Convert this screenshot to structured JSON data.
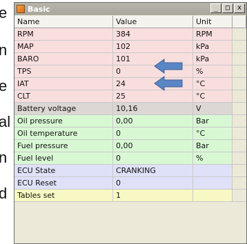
{
  "background_text": [
    "e",
    "n",
    "e",
    "al",
    "n",
    "d"
  ],
  "window": {
    "title": "Basic",
    "buttons": {
      "minimize": "_",
      "maximize": "□",
      "close": "x"
    }
  },
  "table": {
    "columns": [
      "Name",
      "Value",
      "Unit"
    ],
    "rows": [
      {
        "name": "RPM",
        "value": "384",
        "unit": "RPM",
        "color": "#f9dede"
      },
      {
        "name": "MAP",
        "value": "102",
        "unit": "kPa",
        "color": "#f9dede"
      },
      {
        "name": "BARO",
        "value": "101",
        "unit": "kPa",
        "color": "#f9dede"
      },
      {
        "name": "TPS",
        "value": "0",
        "unit": "%",
        "color": "#f9dede"
      },
      {
        "name": "IAT",
        "value": "24",
        "unit": "°C",
        "color": "#f9dede"
      },
      {
        "name": "CLT",
        "value": "25",
        "unit": "°C",
        "color": "#f9dede"
      },
      {
        "name": "Battery voltage",
        "value": "10,16",
        "unit": "V",
        "color": "#dcd7d4"
      },
      {
        "name": "Oil pressure",
        "value": "0,00",
        "unit": "Bar",
        "color": "#d8f8d4"
      },
      {
        "name": "Oil temperature",
        "value": "0",
        "unit": "°C",
        "color": "#d8f8d4"
      },
      {
        "name": "Fuel pressure",
        "value": "0,00",
        "unit": "Bar",
        "color": "#d8f8d4"
      },
      {
        "name": "Fuel level",
        "value": "0",
        "unit": "%",
        "color": "#d8f8d4"
      },
      {
        "name": "ECU State",
        "value": "CRANKING",
        "unit": "",
        "color": "#dfe1f8"
      },
      {
        "name": "ECU Reset",
        "value": "0",
        "unit": "",
        "color": "#dfe1f8"
      },
      {
        "name": "Tables set",
        "value": "1",
        "unit": "",
        "color": "#f8f8c4"
      }
    ]
  },
  "annotations": {
    "arrow_icon": "blue-left-arrow",
    "arrow_color": "#5b86c5"
  }
}
